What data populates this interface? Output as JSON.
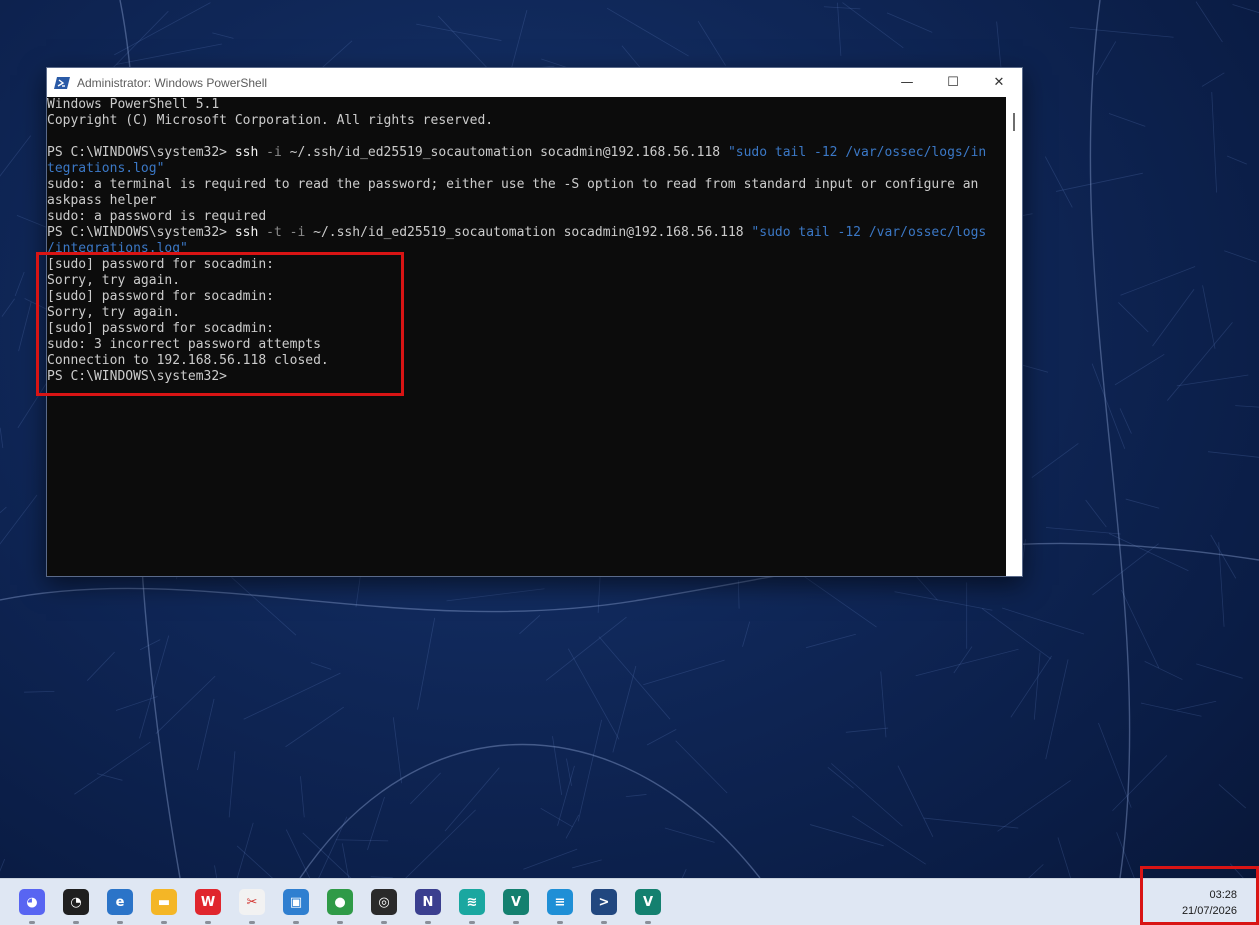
{
  "window": {
    "title": "Administrator: Windows PowerShell",
    "controls": {
      "minimize": "—",
      "maximize": "☐",
      "close": "✕"
    }
  },
  "console": {
    "lines": [
      [
        {
          "t": "Windows PowerShell 5.1",
          "c": "out"
        }
      ],
      [
        {
          "t": "Copyright (C) Microsoft Corporation. All rights reserved.",
          "c": "out"
        }
      ],
      [
        {
          "t": "",
          "c": "out"
        }
      ],
      [
        {
          "t": "PS C:\\WINDOWS\\system32> ",
          "c": "out"
        },
        {
          "t": "ssh",
          "c": "cmd"
        },
        {
          "t": " -i ",
          "c": "flag"
        },
        {
          "t": "~/.ssh/id_ed25519_socautomation socadmin@192.168.56.118 ",
          "c": "out"
        },
        {
          "t": "\"sudo tail -12 /var/ossec/logs/in",
          "c": "str"
        }
      ],
      [
        {
          "t": "tegrations.log\"",
          "c": "str"
        }
      ],
      [
        {
          "t": "sudo: a terminal is required to read the password; either use the -S option to read from standard input or configure an",
          "c": "out"
        }
      ],
      [
        {
          "t": "askpass helper",
          "c": "out"
        }
      ],
      [
        {
          "t": "sudo: a password is required",
          "c": "out"
        }
      ],
      [
        {
          "t": "PS C:\\WINDOWS\\system32> ",
          "c": "out"
        },
        {
          "t": "ssh",
          "c": "cmd"
        },
        {
          "t": " -t -i ",
          "c": "flag"
        },
        {
          "t": "~/.ssh/id_ed25519_socautomation socadmin@192.168.56.118 ",
          "c": "out"
        },
        {
          "t": "\"sudo tail -12 /var/ossec/logs",
          "c": "str"
        }
      ],
      [
        {
          "t": "/integrations.log\"",
          "c": "str"
        }
      ],
      [
        {
          "t": "[sudo] password for socadmin:",
          "c": "out"
        }
      ],
      [
        {
          "t": "Sorry, try again.",
          "c": "out"
        }
      ],
      [
        {
          "t": "[sudo] password for socadmin:",
          "c": "out"
        }
      ],
      [
        {
          "t": "Sorry, try again.",
          "c": "out"
        }
      ],
      [
        {
          "t": "[sudo] password for socadmin:",
          "c": "out"
        }
      ],
      [
        {
          "t": "sudo: 3 incorrect password attempts",
          "c": "out"
        }
      ],
      [
        {
          "t": "Connection to 192.168.56.118 closed.",
          "c": "out"
        }
      ],
      [
        {
          "t": "PS C:\\WINDOWS\\system32>",
          "c": "out"
        }
      ]
    ]
  },
  "colors": {
    "highlight": "#d91414",
    "console_text": "#cccccc",
    "console_string": "#3b78c6",
    "console_flag": "#8a8a8a"
  },
  "taskbar": {
    "apps": [
      {
        "name": "discord-icon",
        "bg": "#5865f2",
        "glyph": "◕"
      },
      {
        "name": "speedometer-icon",
        "bg": "#1f1f1f",
        "glyph": "◔"
      },
      {
        "name": "edge-icon",
        "bg": "#2b74c8",
        "glyph": "e"
      },
      {
        "name": "file-explorer-icon",
        "bg": "#f4b626",
        "glyph": "▬"
      },
      {
        "name": "wps-office-icon",
        "bg": "#e0262d",
        "glyph": "W"
      },
      {
        "name": "snipping-tool-icon",
        "bg": "#f2f2f2",
        "glyph": "✂"
      },
      {
        "name": "virtualbox-icon",
        "bg": "#2f7fd0",
        "glyph": "▣"
      },
      {
        "name": "chrome-icon",
        "bg": "#2f9a47",
        "glyph": "●"
      },
      {
        "name": "obs-icon",
        "bg": "#2a2a2a",
        "glyph": "◎"
      },
      {
        "name": "notion-icon",
        "bg": "#3b3f8f",
        "glyph": "N"
      },
      {
        "name": "wave-icon",
        "bg": "#1aa7a0",
        "glyph": "≋"
      },
      {
        "name": "vmware-icon",
        "bg": "#14806f",
        "glyph": "V"
      },
      {
        "name": "notepad-icon",
        "bg": "#1f8fd6",
        "glyph": "≡"
      },
      {
        "name": "powershell-icon",
        "bg": "#21477f",
        "glyph": ">"
      },
      {
        "name": "vmware-2-icon",
        "bg": "#14806f",
        "glyph": "V"
      }
    ]
  },
  "clock": {
    "time": "03:28",
    "date": "21/07/2026"
  }
}
